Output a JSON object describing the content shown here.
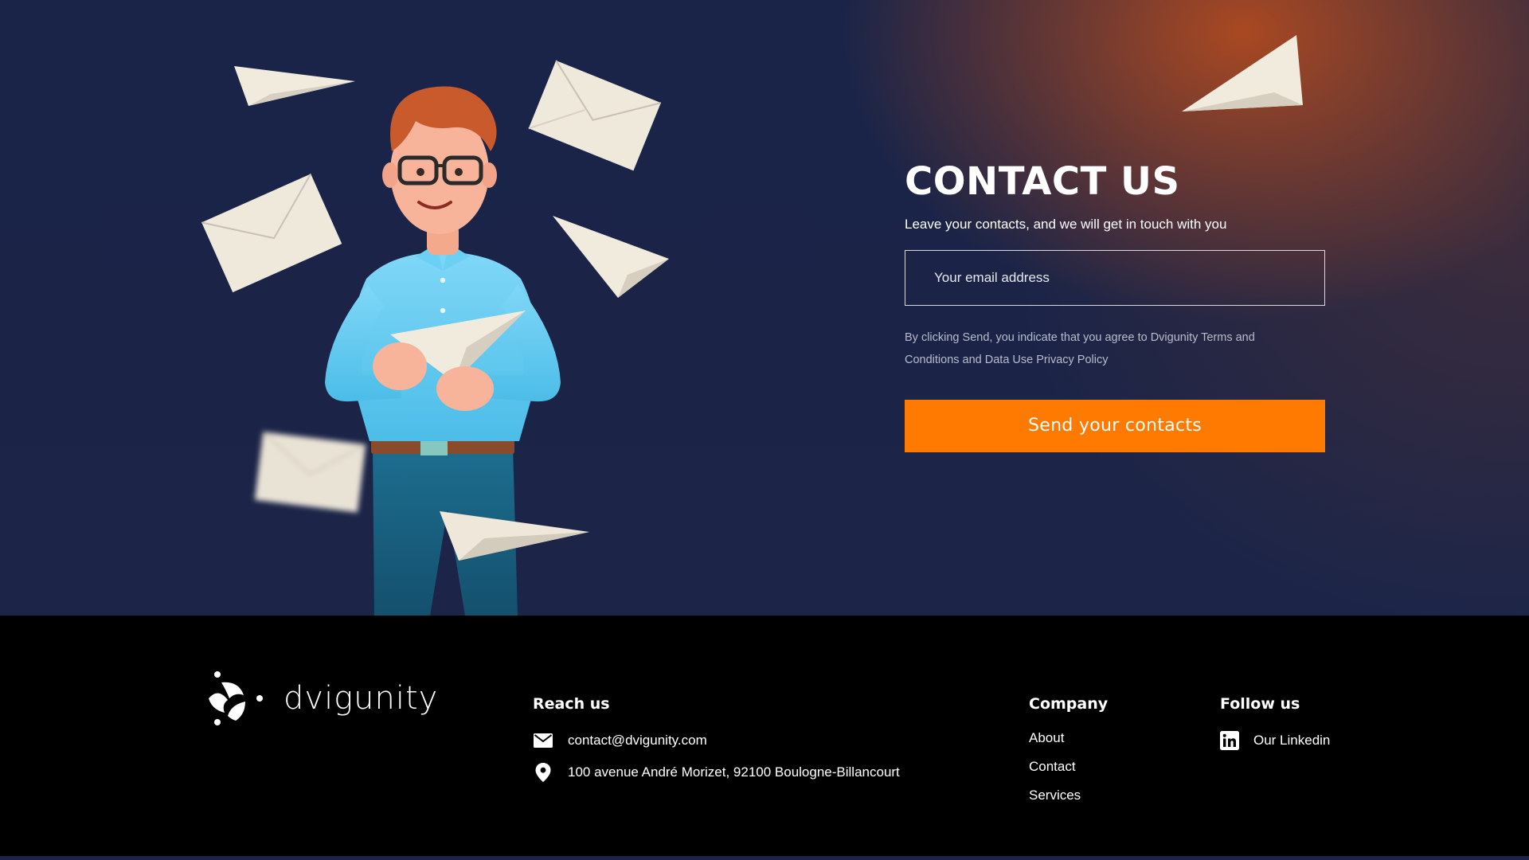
{
  "hero": {
    "title": "CONTACT US",
    "subtitle": "Leave your contacts, and we will get in touch with you",
    "email_placeholder": "Your email address",
    "consent_text": "By clicking Send, you indicate that you agree to Dvigunity Terms and Conditions and Data Use Privacy Policy",
    "send_label": "Send your contacts"
  },
  "brand": {
    "name": "dvigunity",
    "logo_icon": "dvigunity-logo-icon"
  },
  "footer": {
    "reach": {
      "heading": "Reach us",
      "email": "contact@dvigunity.com",
      "email_icon": "mail-icon",
      "address": "100 avenue André Morizet, 92100 Boulogne-Billancourt",
      "address_icon": "location-pin-icon"
    },
    "company": {
      "heading": "Company",
      "links": [
        "About",
        "Contact",
        "Services"
      ]
    },
    "follow": {
      "heading": "Follow us",
      "linkedin_label": "Our Linkedin",
      "linkedin_icon": "linkedin-icon"
    }
  },
  "colors": {
    "hero_background": "#1b2447",
    "hero_glow": "#d65416",
    "accent": "#ff7a00",
    "footer_background": "#000000",
    "text": "#ffffff"
  }
}
